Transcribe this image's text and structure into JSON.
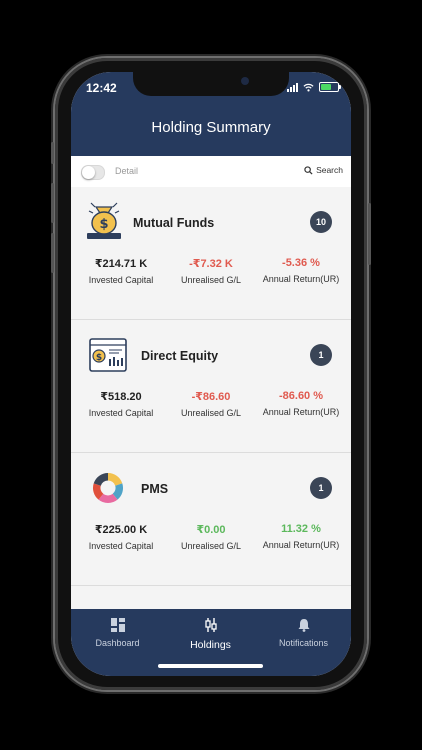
{
  "status": {
    "time": "12:42"
  },
  "header": {
    "title": "Holding Summary"
  },
  "toolbar": {
    "detail_label": "Detail",
    "search_label": "Search"
  },
  "cards": [
    {
      "name": "Mutual Funds",
      "count": "10",
      "icon": "money-bag-icon",
      "metrics": [
        {
          "value": "₹214.71 K",
          "label": "Invested Capital"
        },
        {
          "value": "-₹7.32 K",
          "label": "Unrealised G/L"
        },
        {
          "value": "-5.36 %",
          "label": "Annual Return(UR)"
        }
      ]
    },
    {
      "name": "Direct Equity",
      "count": "1",
      "icon": "stock-chart-icon",
      "metrics": [
        {
          "value": "₹518.20",
          "label": "Invested Capital"
        },
        {
          "value": "-₹86.60",
          "label": "Unrealised G/L"
        },
        {
          "value": "-86.60 %",
          "label": "Annual Return(UR)"
        }
      ]
    },
    {
      "name": "PMS",
      "count": "1",
      "icon": "pie-ring-icon",
      "metrics": [
        {
          "value": "₹225.00 K",
          "label": "Invested Capital"
        },
        {
          "value": "₹0.00",
          "label": "Unrealised G/L"
        },
        {
          "value": "11.32 %",
          "label": "Annual Return(UR)"
        }
      ]
    }
  ],
  "tabs": [
    {
      "label": "Dashboard",
      "icon": "dashboard-icon",
      "active": false
    },
    {
      "label": "Holdings",
      "icon": "holdings-icon",
      "active": true
    },
    {
      "label": "Notifications",
      "icon": "bell-icon",
      "active": false
    }
  ],
  "colors": {
    "header": "#263a5e",
    "negative": "#e05a4f",
    "positive": "#5cb85c",
    "badge": "#3a4557"
  }
}
